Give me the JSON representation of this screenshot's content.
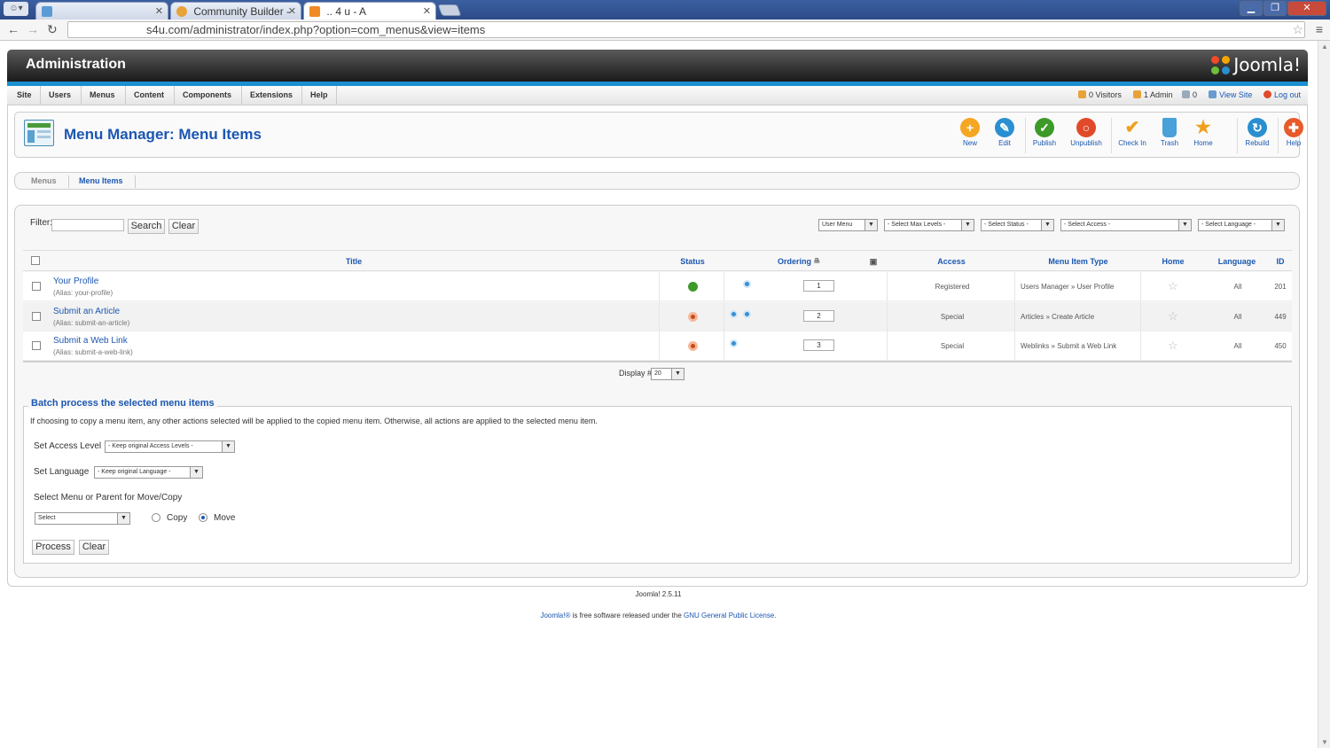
{
  "browser": {
    "tabs": [
      {
        "label": "",
        "favicon_color": "#5b9bd5"
      },
      {
        "label": "Community Builder -",
        "favicon_color": "#e8a23a"
      },
      {
        "label": "..  4 u - A",
        "favicon_color": "#f08a24"
      }
    ],
    "url": "s4u.com/administrator/index.php?option=com_menus&view=items"
  },
  "header": {
    "title": "Administration",
    "logo": "Joomla!"
  },
  "menu": [
    "Site",
    "Users",
    "Menus",
    "Content",
    "Components",
    "Extensions",
    "Help"
  ],
  "status": {
    "visitors": "0 Visitors",
    "admins": "1 Admin",
    "messages": "0",
    "view_site": "View Site",
    "logout": "Log out"
  },
  "page": {
    "title": "Menu Manager: Menu Items"
  },
  "toolbar": [
    {
      "label": "New",
      "icon": "plus-icon",
      "color": "#f5a623"
    },
    {
      "label": "Edit",
      "icon": "pencil-icon",
      "color": "#2a8fd0"
    },
    {
      "label": "Publish",
      "icon": "check-icon",
      "color": "#3d9a2a"
    },
    {
      "label": "Unpublish",
      "icon": "unpublish-icon",
      "color": "#e04a2a"
    },
    {
      "label": "Check In",
      "icon": "checkmark-icon",
      "color": "#f0a020"
    },
    {
      "label": "Trash",
      "icon": "trash-icon",
      "color": "#4aa0d8"
    },
    {
      "label": "Home",
      "icon": "star-icon",
      "color": "#f0a020"
    },
    {
      "label": "Rebuild",
      "icon": "refresh-icon",
      "color": "#2a8fd0"
    },
    {
      "label": "Help",
      "icon": "lifebuoy-icon",
      "color": "#e85a2a"
    }
  ],
  "subtabs": [
    "Menus",
    "Menu Items"
  ],
  "filter": {
    "label": "Filter:",
    "search_button": "Search",
    "clear_button": "Clear",
    "selects": [
      "User Menu",
      "- Select Max Levels -",
      "- Select Status -",
      "- Select Access -",
      "- Select Language -"
    ]
  },
  "table": {
    "headers": {
      "title": "Title",
      "status": "Status",
      "ordering": "Ordering",
      "access": "Access",
      "type": "Menu Item Type",
      "home": "Home",
      "language": "Language",
      "id": "ID"
    },
    "rows": [
      {
        "title": "Your Profile",
        "alias": "(Alias: your-profile)",
        "status": "published",
        "order": "1",
        "access": "Registered",
        "type": "Users Manager » User Profile",
        "language": "All",
        "id": "201"
      },
      {
        "title": "Submit an Article",
        "alias": "(Alias: submit-an-article)",
        "status": "unpublished",
        "order": "2",
        "access": "Special",
        "type": "Articles » Create Article",
        "language": "All",
        "id": "449"
      },
      {
        "title": "Submit a Web Link",
        "alias": "(Alias: submit-a-web-link)",
        "status": "unpublished",
        "order": "3",
        "access": "Special",
        "type": "Weblinks » Submit a Web Link",
        "language": "All",
        "id": "450"
      }
    ],
    "display_label": "Display #",
    "display_value": "20"
  },
  "batch": {
    "legend": "Batch process the selected menu items",
    "note": "If choosing to copy a menu item, any other actions selected will be applied to the copied menu item. Otherwise, all actions are applied to the selected menu item.",
    "access_label": "Set Access Level",
    "access_value": "- Keep original Access Levels -",
    "language_label": "Set Language",
    "language_value": "- Keep original Language -",
    "move_label": "Select Menu or Parent for Move/Copy",
    "move_value": "Select",
    "copy": "Copy",
    "move": "Move",
    "process_button": "Process",
    "clear_button": "Clear"
  },
  "footer": {
    "version": "Joomla! 2.5.11",
    "license_prefix": "Joomla!®",
    "license_middle": "is free software released under the",
    "license_link": "GNU General Public License."
  }
}
